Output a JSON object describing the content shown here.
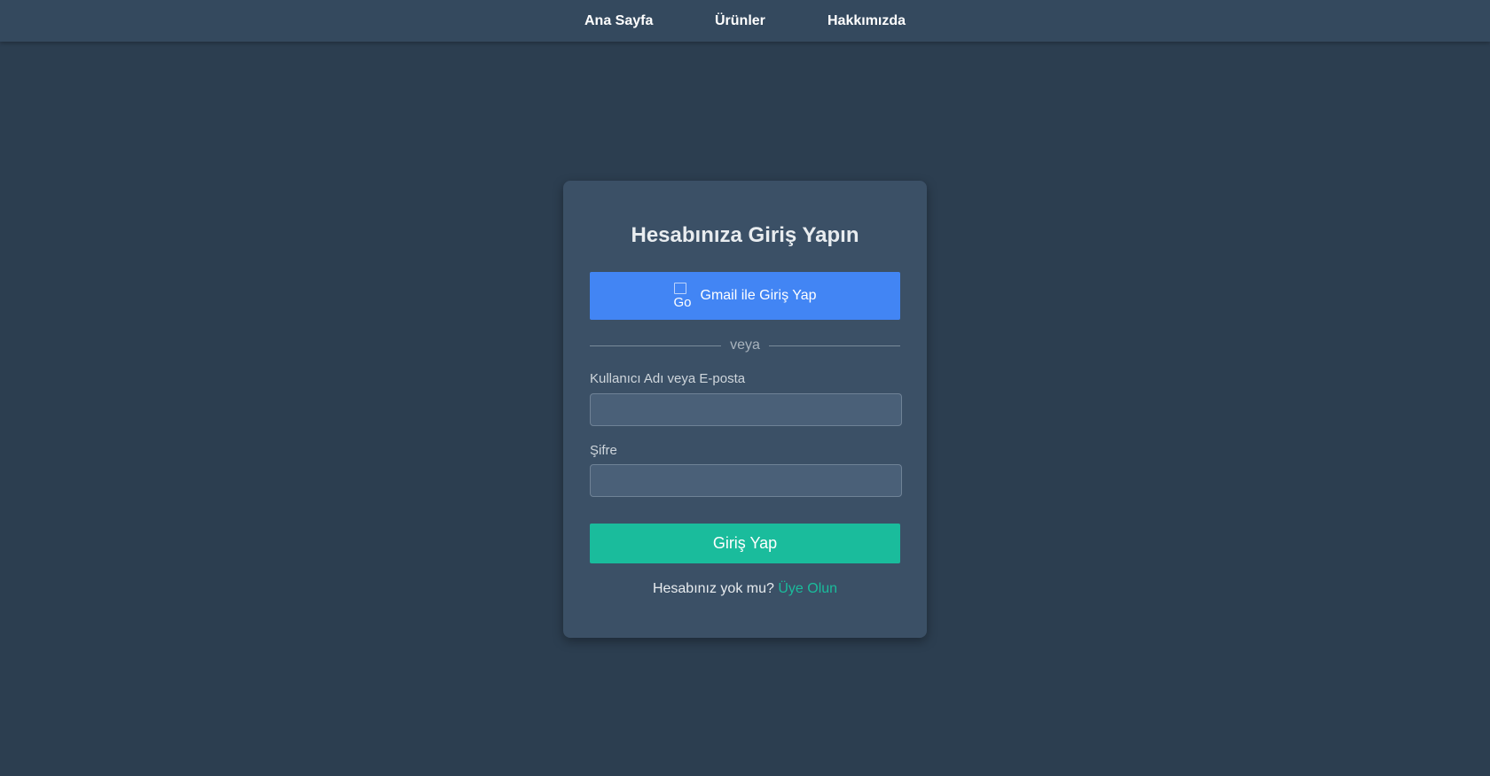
{
  "nav": {
    "items": [
      {
        "label": "Ana Sayfa"
      },
      {
        "label": "Ürünler"
      },
      {
        "label": "Hakkımızda"
      }
    ]
  },
  "login": {
    "title": "Hesabınıza Giriş Yapın",
    "google_button": {
      "label": "Gmail ile Giriş Yap",
      "icon_alt": "Go",
      "icon": "google-icon-broken"
    },
    "divider_text": "veya",
    "username_label": "Kullanıcı Adı veya E-posta",
    "username_value": "",
    "password_label": "Şifre",
    "password_value": "",
    "submit_label": "Giriş Yap",
    "signup_prompt": "Hesabınız yok mu?",
    "signup_link": "Üye Olun"
  },
  "colors": {
    "background": "#2c3e50",
    "navbar": "#34495e",
    "card": "#3b5066",
    "google_blue": "#4285f4",
    "accent": "#1abc9c"
  }
}
